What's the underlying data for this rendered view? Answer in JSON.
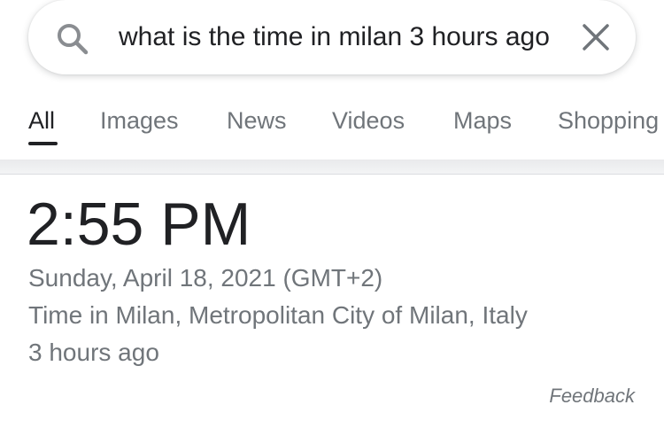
{
  "search": {
    "query": "what is the time in milan 3 hours ago",
    "search_icon": "search-icon",
    "clear_icon": "close-icon"
  },
  "tabs": [
    {
      "label": "All",
      "active": true
    },
    {
      "label": "Images",
      "active": false
    },
    {
      "label": "News",
      "active": false
    },
    {
      "label": "Videos",
      "active": false
    },
    {
      "label": "Maps",
      "active": false
    },
    {
      "label": "Shopping",
      "active": false
    }
  ],
  "result": {
    "time": "2:55 PM",
    "date": "Sunday, April 18, 2021 (GMT+2)",
    "location": "Time in Milan, Metropolitan City of Milan, Italy",
    "relative": "3 hours ago",
    "feedback_label": "Feedback"
  },
  "colors": {
    "text_primary": "#202124",
    "text_secondary": "#70757a"
  }
}
